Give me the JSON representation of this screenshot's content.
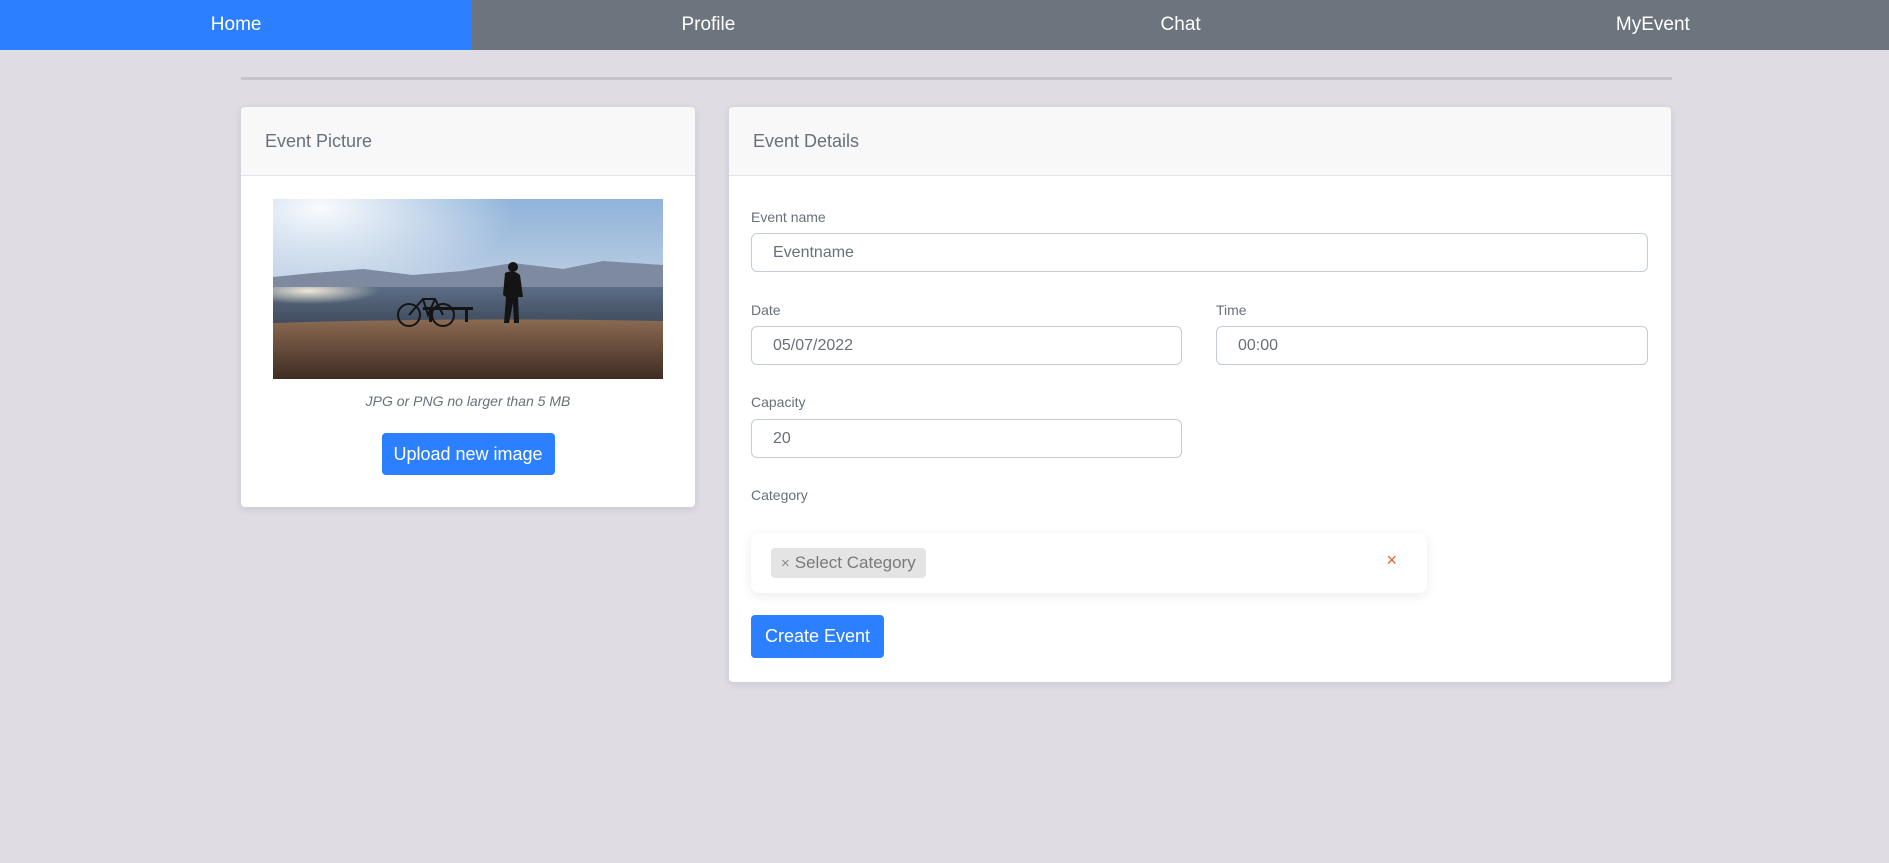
{
  "nav": {
    "items": [
      {
        "label": "Home",
        "active": true
      },
      {
        "label": "Profile",
        "active": false
      },
      {
        "label": "Chat",
        "active": false
      },
      {
        "label": "MyEvent",
        "active": false
      }
    ]
  },
  "picture_card": {
    "title": "Event Picture",
    "hint": "JPG or PNG no larger than 5 MB",
    "upload_label": "Upload new image"
  },
  "details_card": {
    "title": "Event Details",
    "event_name": {
      "label": "Event name",
      "value": "Eventname"
    },
    "date": {
      "label": "Date",
      "value": "05/07/2022"
    },
    "time": {
      "label": "Time",
      "value": "00:00"
    },
    "capacity": {
      "label": "Capacity",
      "value": "20"
    },
    "category": {
      "label": "Category",
      "tag_remove": "×",
      "tag_label": "Select Category",
      "clear": "×"
    },
    "create_label": "Create Event"
  },
  "colors": {
    "accent": "#2c80ff",
    "nav_bg": "#6c757d",
    "page_bg": "#dfdce4",
    "clear_icon": "#e8622a"
  }
}
